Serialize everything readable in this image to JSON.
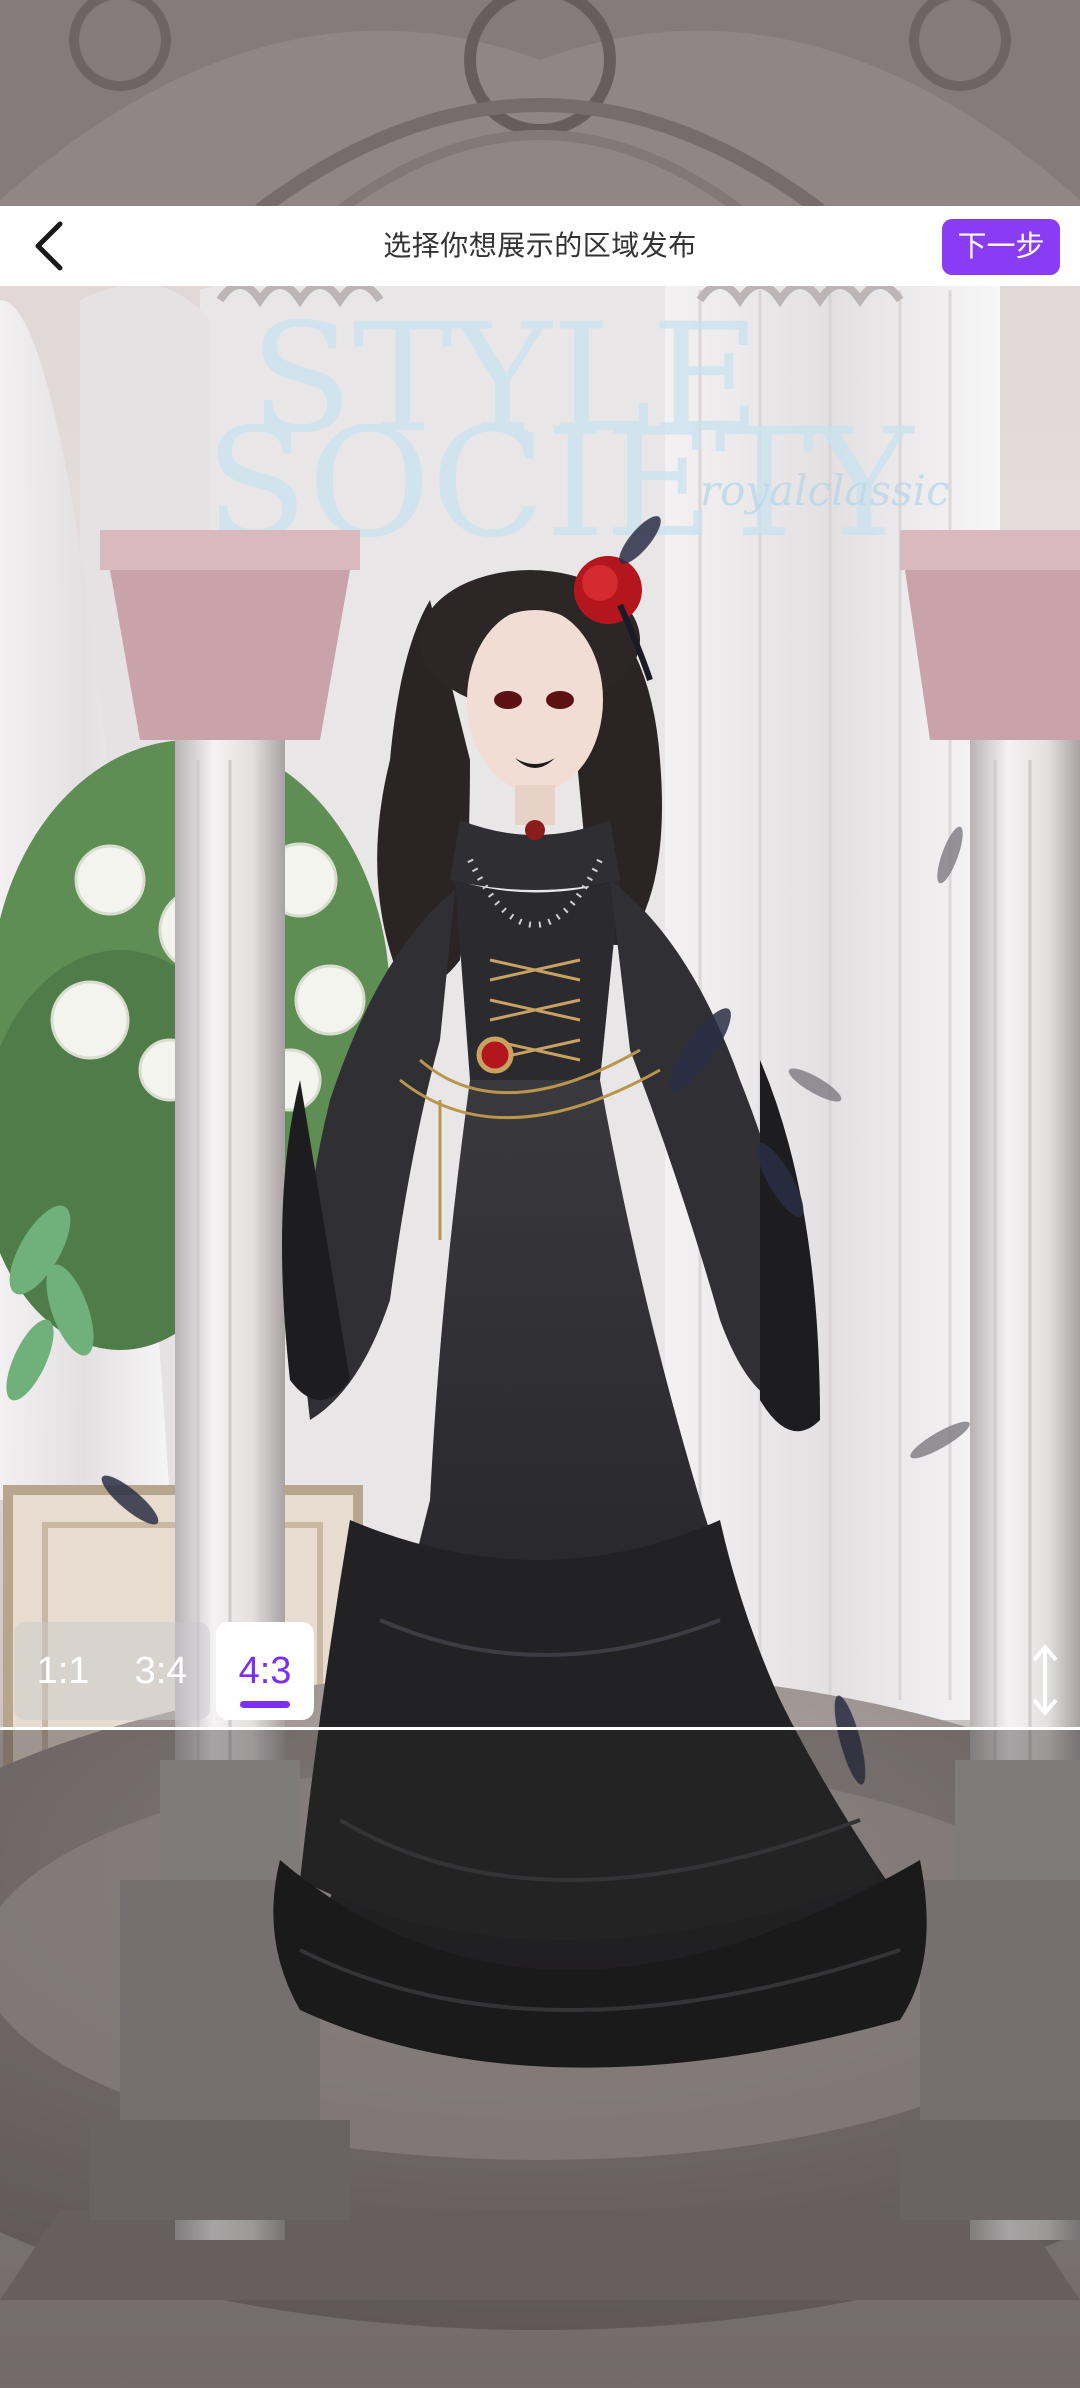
{
  "header": {
    "title": "选择你想展示的区域发布",
    "next_label": "下一步"
  },
  "artwork": {
    "watermark_line1": "STYLE",
    "watermark_line2": "SOCIETY",
    "watermark_script": "royalclassic"
  },
  "ratio_selector": {
    "options": [
      "1:1",
      "3:4",
      "4:3"
    ],
    "selected": "4:3"
  },
  "colors": {
    "accent": "#8a3cf4",
    "header_bg": "#ffffff",
    "title_text": "#333333"
  },
  "icons": {
    "back": "chevron-left-icon",
    "resize": "vertical-resize-arrows-icon"
  }
}
